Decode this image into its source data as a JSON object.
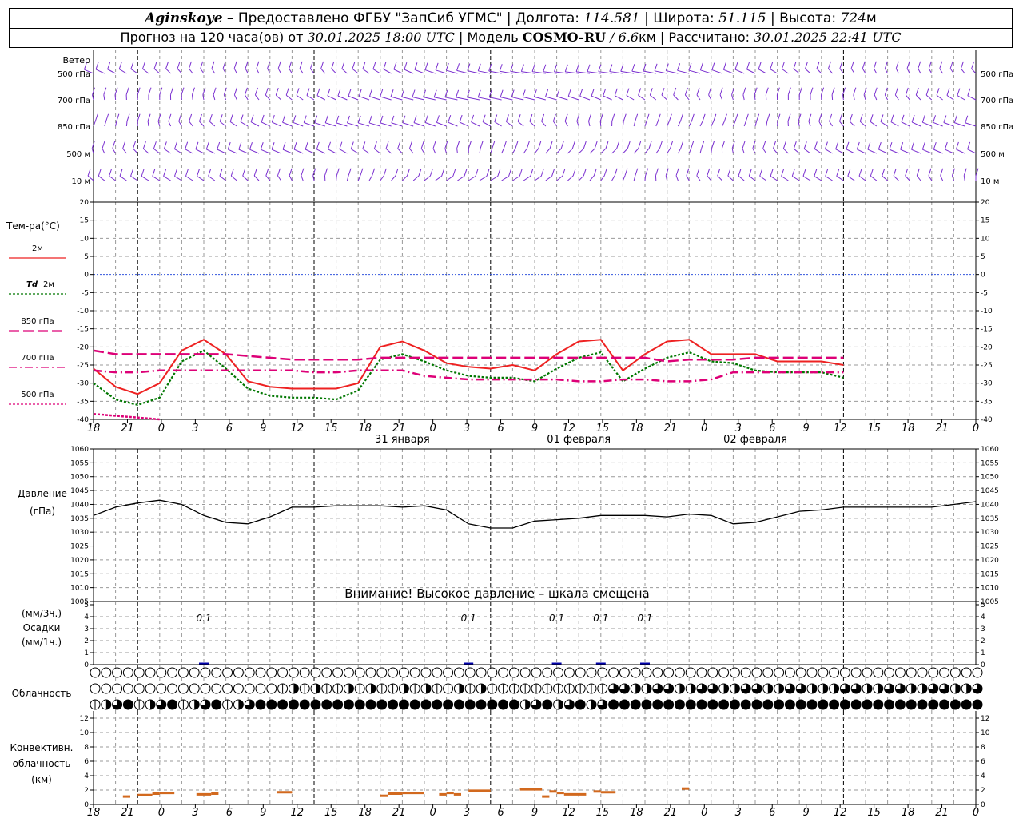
{
  "header": {
    "station": "Aginskoye",
    "provider": "– Предоставлено ФГБУ \"ЗапСиб УГМС\"",
    "lon_label": "Долгота:",
    "lon": "114.581",
    "lat_label": "Широта:",
    "lat": "51.115",
    "alt_label": "Высота:",
    "alt": "724",
    "alt_unit": "м",
    "forecast_label": "Прогноз на 120 часа(ов) от",
    "forecast_start": "30.01.2025 18:00 UTC",
    "model_label": "Модель",
    "model": "COSMO-RU",
    "resolution": "/ 6.6",
    "res_unit": "км",
    "calc_label": "Рассчитано:",
    "calc_time": "30.01.2025 22:41 UTC"
  },
  "wind_panel": {
    "title": "Ветер",
    "levels": [
      "500 гПа",
      "700 гПа",
      "850 гПа",
      "500 м",
      "10 м"
    ]
  },
  "temp_panel": {
    "title": "Тем-ра(°C)",
    "legend": [
      {
        "label": "2м",
        "color": "#ee2222",
        "dash": ""
      },
      {
        "label": "Td 2м",
        "color": "#007700",
        "dash": "3,2"
      },
      {
        "label": "850 гПа",
        "color": "#dd0077",
        "dash": "13,5"
      },
      {
        "label": "700 гПа",
        "color": "#dd0077",
        "dash": "10,4,2,4"
      },
      {
        "label": "500 гПа",
        "color": "#dd0077",
        "dash": "3,2"
      }
    ]
  },
  "pressure_panel": {
    "title": "Давление",
    "unit": "(гПа)",
    "warning": "Внимание! Высокое давление – шкала смещена"
  },
  "precip_panel": {
    "unit3h": "(мм/3ч.)",
    "title": "Осадки",
    "unit1h": "(мм/1ч.)",
    "labels": [
      {
        "t": 15,
        "text": "0.1"
      },
      {
        "t": 51,
        "text": "0.1"
      },
      {
        "t": 63,
        "text": "0.1"
      },
      {
        "t": 69,
        "text": "0.1"
      },
      {
        "t": 75,
        "text": "0.1"
      }
    ]
  },
  "cloud_panel": {
    "title": "Облачность"
  },
  "conv_panel": {
    "title_lines": [
      "Конвективн.",
      "облачность",
      "(км)"
    ]
  },
  "time_axis": {
    "tick_labels": [
      "18",
      "21",
      "0",
      "3",
      "6",
      "9",
      "12",
      "15",
      "18",
      "21",
      "0",
      "3",
      "6",
      "9",
      "12",
      "15",
      "18",
      "21",
      "0",
      "3",
      "6",
      "9",
      "12",
      "15",
      "18",
      "21",
      "0"
    ],
    "day_labels": [
      {
        "t": 42,
        "text": "31 января"
      },
      {
        "t": 66,
        "text": "01 февраля"
      },
      {
        "t": 90,
        "text": "02 февраля"
      }
    ]
  },
  "chart_data": [
    {
      "type": "line",
      "title": "Тем-ра(°C)",
      "x": [
        0,
        3,
        6,
        9,
        12,
        15,
        18,
        21,
        24,
        27,
        30,
        33,
        36,
        39,
        42,
        45,
        48,
        51,
        54,
        57,
        60,
        63,
        66,
        69,
        72
      ],
      "ylim": [
        -40,
        20
      ],
      "yticks": [
        20,
        15,
        10,
        5,
        0,
        -5,
        -10,
        -15,
        -20,
        -25,
        -30,
        -35,
        -40
      ],
      "series": [
        {
          "name": "2м",
          "values": [
            -26,
            -31,
            -33,
            -30,
            -21,
            -18,
            -22,
            -29.5,
            -31,
            -31.5,
            -31.5,
            -31.5,
            -30,
            -20,
            -18.5,
            -21,
            -24.5,
            -25.5,
            -26,
            -25,
            -26.5,
            -22,
            -18.5,
            -18,
            -22
          ]
        },
        {
          "name": "Td 2м",
          "values": [
            -30,
            -34.5,
            -36,
            -34,
            -24,
            -21,
            -26,
            -31.5,
            -33.5,
            -34,
            -34,
            -34.5,
            -32,
            -23.5,
            -22,
            -24,
            -26.5,
            -28,
            -28.5,
            -28.5,
            -29.5,
            -26,
            -23,
            -21.5,
            -24
          ]
        },
        {
          "name": "850 гПа",
          "values": [
            -21,
            -22,
            -22,
            -22,
            -22,
            -22,
            -22,
            -22.5,
            -23,
            -23.5,
            -23.5,
            -23.5,
            -23.5,
            -23,
            -23,
            -23,
            -23,
            -23,
            -23,
            -23,
            -23,
            -23,
            -23,
            -23,
            -23
          ]
        },
        {
          "name": "700 гПа",
          "values": [
            -26.5,
            -27,
            -27,
            -26.5,
            -26.5,
            -26.5,
            -26.5,
            -26.5,
            -26.5,
            -26.5,
            -27,
            -27,
            -26.5,
            -26.5,
            -26.5,
            -28,
            -28.5,
            -29,
            -29,
            -29,
            -29,
            -29,
            -29.5,
            -29.5,
            -29
          ]
        },
        {
          "name": "500 гПа",
          "values": [
            -38.5,
            -39,
            -39.5,
            -40,
            null,
            null,
            null,
            null,
            null,
            null,
            null,
            null,
            null,
            null,
            null,
            null,
            null,
            null,
            null,
            null,
            null,
            null,
            null,
            null,
            null
          ]
        }
      ],
      "extra_x": [
        72,
        75,
        78,
        81,
        84,
        87,
        90,
        93,
        96,
        99,
        102,
        105,
        108,
        111,
        114,
        117,
        120
      ],
      "extra_series": [
        {
          "name": "2м",
          "values": [
            -26.5,
            -22,
            -18.5,
            -18,
            -22,
            -22,
            -22,
            -24,
            -24,
            -24,
            -25
          ]
        },
        {
          "name": "Td 2м",
          "values": [
            -29.5,
            -26,
            -23,
            -21.5,
            -24,
            -24.5,
            -26.5,
            -27,
            -27,
            -27,
            -28.5
          ]
        },
        {
          "name": "850 гПа",
          "values": [
            -23,
            -23,
            -24,
            -23.5,
            -23.5,
            -23.5,
            -23,
            -23,
            -23,
            -23,
            -23
          ]
        },
        {
          "name": "700 гПа",
          "values": [
            -29,
            -29,
            -29.5,
            -29.5,
            -29,
            -27,
            -27,
            -27,
            -27,
            -27,
            -27
          ]
        }
      ]
    },
    {
      "type": "line",
      "title": "Давление",
      "x": [
        0,
        3,
        6,
        9,
        12,
        15,
        18,
        21,
        24,
        27,
        30,
        33,
        36,
        39,
        42,
        45,
        48,
        51,
        54,
        57,
        60,
        63,
        66,
        69,
        72,
        75,
        78,
        81,
        84,
        87,
        90,
        93,
        96,
        99,
        102,
        105,
        108,
        111,
        114,
        117,
        120
      ],
      "ylim": [
        1005,
        1060
      ],
      "yticks": [
        1060,
        1055,
        1050,
        1045,
        1040,
        1035,
        1030,
        1025,
        1020,
        1015,
        1010,
        1005
      ],
      "series": [
        {
          "name": "Давление",
          "values": [
            1036,
            1039,
            1040.5,
            1041.5,
            1040,
            1036,
            1033.5,
            1033,
            1035.5,
            1039,
            1039,
            1039.5,
            1039.5,
            1039.5,
            1039,
            1039.5,
            1038,
            1033,
            1031.5,
            1031.5,
            1034,
            1034.5,
            1035,
            1036,
            1036,
            1036,
            1035.5,
            1036.5,
            1036,
            1033,
            1033.5,
            1035.5,
            1037.5,
            1038,
            1039,
            1039,
            1039,
            1039,
            1039,
            1040,
            1041
          ]
        }
      ]
    },
    {
      "type": "bar",
      "title": "Осадки",
      "ylim": [
        0,
        5
      ],
      "yticks": [
        5,
        4,
        3,
        2,
        1,
        0
      ],
      "x": [
        15,
        51,
        63,
        69,
        75
      ],
      "values": [
        0.1,
        0.1,
        0.1,
        0.1,
        0.1
      ]
    },
    {
      "type": "bar",
      "title": "Конвективн. облачность (км)",
      "ylim": [
        0,
        13
      ],
      "yticks": [
        12,
        10,
        8,
        6,
        4,
        2,
        0
      ],
      "segments": [
        {
          "t0": 4,
          "t1": 5,
          "y": 1.1
        },
        {
          "t0": 6,
          "t1": 8,
          "y": 1.3
        },
        {
          "t0": 8,
          "t1": 9,
          "y": 1.5
        },
        {
          "t0": 9,
          "t1": 11,
          "y": 1.6
        },
        {
          "t0": 14,
          "t1": 16,
          "y": 1.4
        },
        {
          "t0": 16,
          "t1": 17,
          "y": 1.5
        },
        {
          "t0": 25,
          "t1": 27,
          "y": 1.7
        },
        {
          "t0": 39,
          "t1": 40,
          "y": 1.2
        },
        {
          "t0": 40,
          "t1": 42,
          "y": 1.5
        },
        {
          "t0": 42,
          "t1": 45,
          "y": 1.6
        },
        {
          "t0": 47,
          "t1": 48,
          "y": 1.4
        },
        {
          "t0": 48,
          "t1": 49,
          "y": 1.6
        },
        {
          "t0": 49,
          "t1": 50,
          "y": 1.4
        },
        {
          "t0": 51,
          "t1": 54,
          "y": 1.9
        },
        {
          "t0": 58,
          "t1": 61,
          "y": 2.1
        },
        {
          "t0": 61,
          "t1": 62,
          "y": 1.1
        },
        {
          "t0": 62,
          "t1": 63,
          "y": 1.8
        },
        {
          "t0": 63,
          "t1": 64,
          "y": 1.6
        },
        {
          "t0": 64,
          "t1": 67,
          "y": 1.4
        },
        {
          "t0": 68,
          "t1": 69,
          "y": 1.8
        },
        {
          "t0": 69,
          "t1": 71,
          "y": 1.7
        },
        {
          "t0": 80,
          "t1": 81,
          "y": 2.2
        }
      ]
    }
  ]
}
